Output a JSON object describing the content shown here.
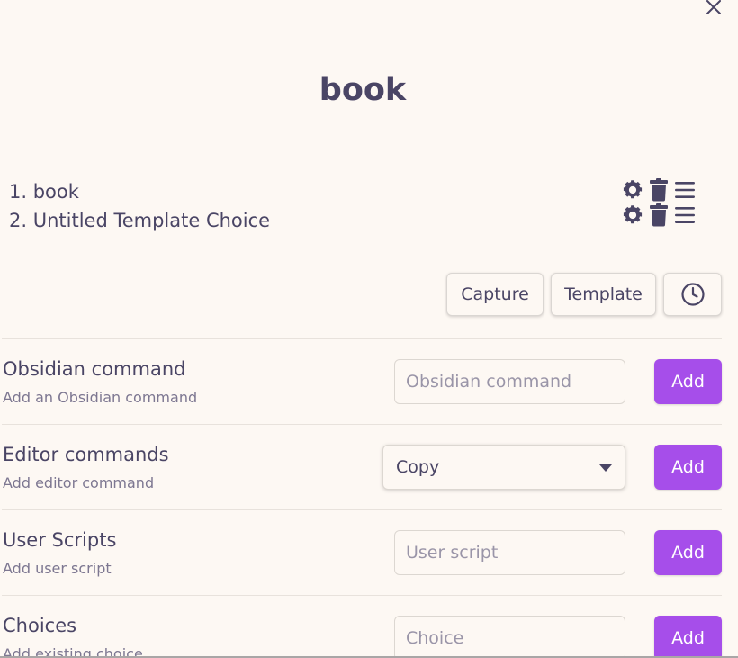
{
  "modal": {
    "title": "book",
    "close_icon": "close-icon"
  },
  "macro_commands": [
    {
      "label": "1. book",
      "icons": [
        "gear-icon",
        "trash-icon",
        "drag-handle-icon"
      ]
    },
    {
      "label": "2. Untitled Template Choice",
      "icons": [
        "gear-icon",
        "trash-icon",
        "drag-handle-icon"
      ]
    }
  ],
  "type_buttons": {
    "capture_label": "Capture",
    "template_label": "Template",
    "wait_icon": "clock-icon"
  },
  "settings": {
    "obsidian_command": {
      "name": "Obsidian command",
      "desc": "Add an Obsidian command",
      "placeholder": "Obsidian command",
      "value": "",
      "add_label": "Add"
    },
    "editor_commands": {
      "name": "Editor commands",
      "desc": "Add editor command",
      "selected": "Copy",
      "add_label": "Add"
    },
    "user_scripts": {
      "name": "User Scripts",
      "desc": "Add user script",
      "placeholder": "User script",
      "value": "",
      "add_label": "Add"
    },
    "choices": {
      "name": "Choices",
      "desc": "Add existing choice",
      "placeholder": "Choice",
      "value": "",
      "add_label": "Add"
    }
  },
  "colors": {
    "background": "#fdf8f3",
    "text": "#4a4565",
    "muted_text": "#7d7791",
    "accent": "#a64eea",
    "border": "#dcd7d1"
  }
}
